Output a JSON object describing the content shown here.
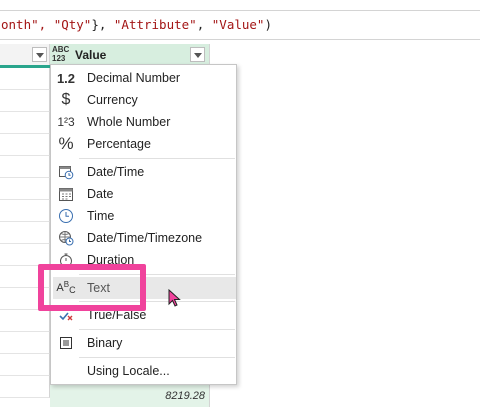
{
  "formula": {
    "pre": "onth\", ",
    "qty": "\"Qty\"",
    "mid": "}, ",
    "attr": "\"Attribute\"",
    "comma": ", ",
    "val": "\"Value\"",
    "end": ")"
  },
  "column": {
    "type_icon_top": "ABC",
    "type_icon_bottom": "123",
    "title": "Value"
  },
  "grid": {
    "last_value": "8219.28"
  },
  "menu": {
    "items": [
      {
        "icon": "1.2",
        "label": "Decimal Number"
      },
      {
        "icon": "$",
        "label": "Currency"
      },
      {
        "icon": "1²3",
        "label": "Whole Number"
      },
      {
        "icon": "%",
        "label": "Percentage"
      },
      {
        "icon": "calendar-clock-icon",
        "label": "Date/Time"
      },
      {
        "icon": "calendar-icon",
        "label": "Date"
      },
      {
        "icon": "clock-icon",
        "label": "Time"
      },
      {
        "icon": "globe-clock-icon",
        "label": "Date/Time/Timezone"
      },
      {
        "icon": "stopwatch-icon",
        "label": "Duration"
      },
      {
        "icon": "ABC",
        "label": "Text"
      },
      {
        "icon": "checkmark-cross-icon",
        "label": "True/False"
      },
      {
        "icon": "binary-icon",
        "label": "Binary"
      },
      {
        "icon": "",
        "label": "Using Locale..."
      }
    ]
  },
  "colors": {
    "highlight": "#f0439c",
    "column_header_bg": "#d7eedf",
    "column_bg": "#e3f3e8",
    "teal_accent": "#2aa58c",
    "formula_string": "#a31515"
  }
}
